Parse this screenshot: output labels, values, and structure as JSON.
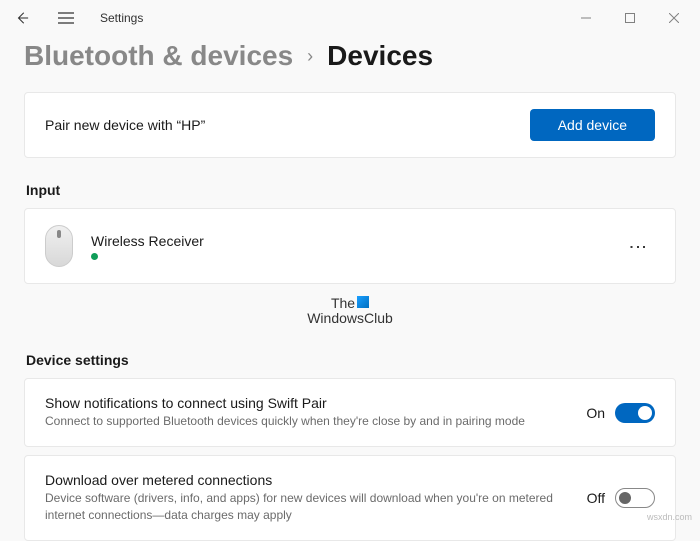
{
  "titlebar": {
    "title": "Settings"
  },
  "breadcrumb": {
    "parent": "Bluetooth & devices",
    "current": "Devices"
  },
  "pair_card": {
    "text": "Pair new device with “HP”",
    "button": "Add device"
  },
  "sections": {
    "input_label": "Input",
    "device_settings_label": "Device settings"
  },
  "input_device": {
    "name": "Wireless Receiver"
  },
  "watermark": {
    "line1": "The",
    "line2": "WindowsClub"
  },
  "settings": {
    "swift_pair": {
      "title": "Show notifications to connect using Swift Pair",
      "desc": "Connect to supported Bluetooth devices quickly when they're close by and in pairing mode",
      "state_label": "On",
      "on": true
    },
    "metered": {
      "title": "Download over metered connections",
      "desc": "Device software (drivers, info, and apps) for new devices will download when you're on metered internet connections—data charges may apply",
      "state_label": "Off",
      "on": false
    }
  },
  "attribution": "wsxdn.com"
}
